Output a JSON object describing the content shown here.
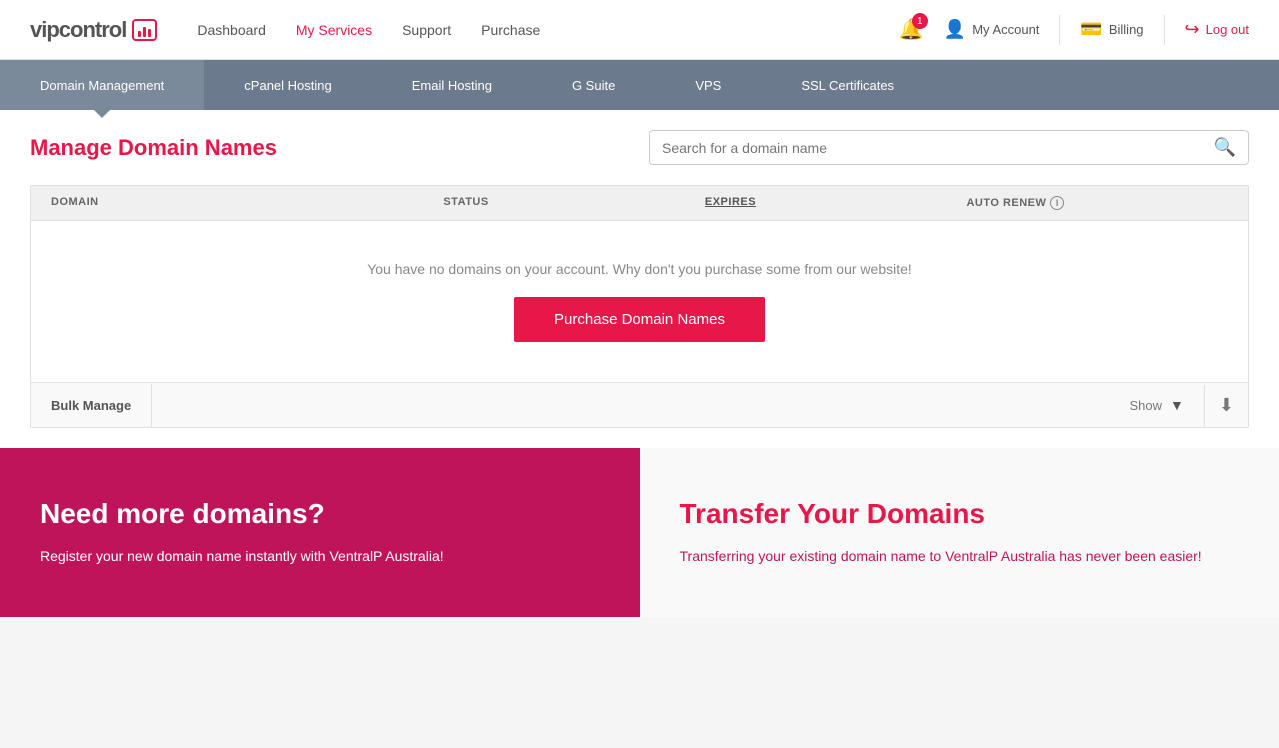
{
  "header": {
    "logo_vip": "vip",
    "logo_control": "control",
    "nav": {
      "items": [
        {
          "label": "Dashboard",
          "active": false
        },
        {
          "label": "My Services",
          "active": true
        },
        {
          "label": "Support",
          "active": false
        },
        {
          "label": "Purchase",
          "active": false
        }
      ]
    },
    "notification_count": "1",
    "my_account_label": "My Account",
    "billing_label": "Billing",
    "logout_label": "Log out"
  },
  "sub_nav": {
    "items": [
      {
        "label": "Domain Management",
        "active": true
      },
      {
        "label": "cPanel Hosting",
        "active": false
      },
      {
        "label": "Email Hosting",
        "active": false
      },
      {
        "label": "G Suite",
        "active": false
      },
      {
        "label": "VPS",
        "active": false
      },
      {
        "label": "SSL Certificates",
        "active": false
      }
    ]
  },
  "page": {
    "title": "Manage Domain Names",
    "search_placeholder": "Search for a domain name",
    "table": {
      "columns": [
        {
          "label": "DOMAIN",
          "sortable": false
        },
        {
          "label": "STATUS",
          "sortable": false
        },
        {
          "label": "EXPIRES",
          "sortable": true
        },
        {
          "label": "AUTO RENEW",
          "sortable": false,
          "info": true
        }
      ],
      "empty_message": "You have no domains on your account. Why don't you purchase some from our website!",
      "purchase_btn_label": "Purchase Domain Names"
    },
    "footer": {
      "bulk_manage_label": "Bulk Manage",
      "show_label": "Show"
    }
  },
  "promo": {
    "left": {
      "title": "Need more domains?",
      "description": "Register your new domain name instantly with VentralP Australia!"
    },
    "right": {
      "title": "Transfer Your Domains",
      "description": "Transferring your existing domain name to VentralP Australia has never been easier!"
    }
  }
}
